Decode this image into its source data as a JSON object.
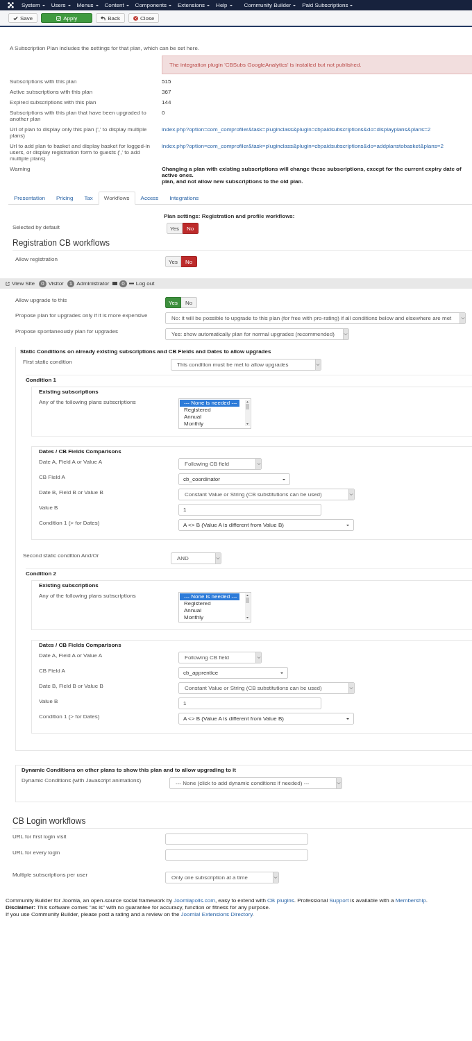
{
  "menubar": {
    "items": [
      "System",
      "Users",
      "Menus",
      "Content",
      "Components",
      "Extensions",
      "Help",
      "Community Builder",
      "Paid Subscriptions"
    ]
  },
  "toolbar": {
    "buttons": [
      {
        "label": "Save",
        "kind": "save"
      },
      {
        "label": "Apply",
        "kind": "apply"
      },
      {
        "label": "Back",
        "kind": "back"
      },
      {
        "label": "Close",
        "kind": "close"
      }
    ]
  },
  "intro": "A Subscription Plan includes the settings for that plan, which can be set here.",
  "alert": "The integration plugin 'CBSubs GoogleAnalytics' is installed but not published.",
  "info_rows": [
    {
      "kind": "text",
      "label": "Subscriptions with this plan",
      "value": "515"
    },
    {
      "kind": "text",
      "label": "Active subscriptions with this plan",
      "value": "367"
    },
    {
      "kind": "text",
      "label": "Expired subscriptions with this plan",
      "value": "144"
    },
    {
      "kind": "text",
      "label": "Subscriptions with this plan that have been upgraded to another plan",
      "value": "0"
    },
    {
      "kind": "link",
      "label": "Url of plan to display only this plan (',' to display multiple plans)",
      "value": "index.php?option=com_comprofiler&task=pluginclass&plugin=cbpaidsubscriptions&do=displayplans&plans=2"
    },
    {
      "kind": "link",
      "label": "Url to add plan to basket and display basket for logged-in users, or display registration form to guests (',' to add multiple plans)",
      "value": "index.php?option=com_comprofiler&task=pluginclass&plugin=cbpaidsubscriptions&do=addplanstobasket&plans=2"
    },
    {
      "kind": "warning",
      "label": "Warning",
      "lines": [
        "Changing a plan with existing subscriptions will change these subscriptions, except for the current expiry date of active ones.",
        "plan, and not allow new subscriptions to the old plan."
      ]
    }
  ],
  "tabs": [
    {
      "label": "Presentation",
      "selected": false
    },
    {
      "label": "Pricing",
      "selected": false
    },
    {
      "label": "Tax",
      "selected": false
    },
    {
      "label": "Workflows",
      "selected": true
    },
    {
      "label": "Access",
      "selected": false
    },
    {
      "label": "Integrations",
      "selected": false
    }
  ],
  "plan_settings_heading": "Plan settings: Registration and profile workflows:",
  "selected_by_default": {
    "kind": "toggle",
    "label": "Selected by default",
    "options": [
      {
        "label": "Yes",
        "selected": false
      },
      {
        "label": "No",
        "selected": true
      }
    ]
  },
  "registration": {
    "title": "Registration CB workflows",
    "rows": [
      {
        "kind": "toggle",
        "label": "Allow registration",
        "options": [
          {
            "label": "Yes",
            "selected": false
          },
          {
            "label": "No",
            "selected": true
          }
        ]
      }
    ]
  },
  "status_bar": {
    "items": [
      {
        "kind": "link",
        "label": "View Site"
      },
      {
        "kind": "badge",
        "count": "0",
        "label": "Visitor"
      },
      {
        "kind": "badge",
        "count": "1",
        "label": "Administrator"
      },
      {
        "kind": "mail",
        "count": "0"
      },
      {
        "kind": "logout",
        "label": "Log out"
      }
    ]
  },
  "upgrade_rows": [
    {
      "kind": "toggle",
      "label": "Allow upgrade to this",
      "options": [
        {
          "label": "Yes",
          "selected": true
        },
        {
          "label": "No",
          "selected": false
        }
      ]
    },
    {
      "kind": "select",
      "label": "Propose plan for upgrades only if it is more expensive",
      "value": "No: it will be possible to upgrade to this plan (for free with pro-rating) if all conditions below and elsewhere are met"
    },
    {
      "kind": "select",
      "label": "Propose spontaneously plan for upgrades",
      "value": "Yes: show automatically plan for normal upgrades (recommended)"
    }
  ],
  "static_conditions": {
    "title": "Static Conditions on already existing subscriptions and CB Fields and Dates to allow upgrades",
    "items": [
      {
        "kind": "select",
        "label": "First static condition",
        "value": "This condition must be met to allow upgrades"
      },
      {
        "kind": "condition",
        "title": "Condition 1",
        "existing": {
          "title": "Existing subscriptions",
          "label": "Any of the following plans subscriptions",
          "options": [
            {
              "label": "--- None is needed ---",
              "selected": true
            },
            {
              "label": "Registered",
              "selected": false
            },
            {
              "label": "Annual",
              "selected": false
            },
            {
              "label": "Monthly",
              "selected": false
            }
          ]
        },
        "comparisons": {
          "title": "Dates / CB Fields Comparisons",
          "rows": [
            {
              "kind": "select",
              "label": "Date A, Field A or Value A",
              "value": "Following CB field"
            },
            {
              "kind": "dropdown",
              "label": "CB Field A",
              "value": "cb_coordinator"
            },
            {
              "kind": "select",
              "label": "Date B, Field B or Value B",
              "value": "Constant Value or String (CB substitutions can be used)"
            },
            {
              "kind": "input",
              "label": "Value B",
              "value": "1"
            },
            {
              "kind": "dropdown",
              "label": "Condition 1 (> for Dates)",
              "value": "A <> B (Value A is different from Value B)"
            }
          ]
        }
      },
      {
        "kind": "select",
        "label": "Second static condition And/Or",
        "value": "AND"
      },
      {
        "kind": "condition",
        "title": "Condition 2",
        "existing": {
          "title": "Existing subscriptions",
          "label": "Any of the following plans subscriptions",
          "options": [
            {
              "label": "--- None is needed ---",
              "selected": true
            },
            {
              "label": "Registered",
              "selected": false
            },
            {
              "label": "Annual",
              "selected": false
            },
            {
              "label": "Monthly",
              "selected": false
            }
          ]
        },
        "comparisons": {
          "title": "Dates / CB Fields Comparisons",
          "rows": [
            {
              "kind": "select",
              "label": "Date A, Field A or Value A",
              "value": "Following CB field"
            },
            {
              "kind": "dropdown",
              "label": "CB Field A",
              "value": "cb_apprentice"
            },
            {
              "kind": "select",
              "label": "Date B, Field B or Value B",
              "value": "Constant Value or String (CB substitutions can be used)"
            },
            {
              "kind": "input",
              "label": "Value B",
              "value": "1"
            },
            {
              "kind": "dropdown",
              "label": "Condition 1 (> for Dates)",
              "value": "A <> B (Value A is different from Value B)"
            }
          ]
        }
      }
    ]
  },
  "dynamic_conditions": {
    "title": "Dynamic Conditions on other plans to show this plan and to allow upgrading to it",
    "rows": [
      {
        "kind": "select",
        "label": "Dynamic Conditions (with Javascript animations)",
        "value": "--- None (click to add dynamic conditions if needed) ---"
      }
    ]
  },
  "login": {
    "title": "CB Login workflows",
    "rows": [
      {
        "kind": "input",
        "label": "URL for first login visit"
      },
      {
        "kind": "input",
        "label": "URL for every login"
      },
      {
        "kind": "select",
        "label": "Multiple subscriptions per user",
        "value": "Only one subscription at a time"
      }
    ]
  },
  "footer": [
    [
      {
        "text": "Community Builder for Joomla, an open-source social framework by ",
        "kind": "text"
      },
      {
        "text": "Joomlapolis.com",
        "kind": "link"
      },
      {
        "text": ", easy to extend with ",
        "kind": "text"
      },
      {
        "text": "CB plugins",
        "kind": "link"
      },
      {
        "text": ". Professional ",
        "kind": "text"
      },
      {
        "text": "Support",
        "kind": "link"
      },
      {
        "text": " is available with a ",
        "kind": "text"
      },
      {
        "text": "Membership",
        "kind": "link"
      },
      {
        "text": ".",
        "kind": "text"
      }
    ],
    [
      {
        "text": "**Disclaimer:** This software comes \"as is\" with no guarantee for accuracy, function or fitness for any purpose.",
        "kind": "text"
      }
    ],
    [
      {
        "text": "If you use Community Builder, please post a rating and a review on the ",
        "kind": "text"
      },
      {
        "text": "Joomla! Extensions Directory",
        "kind": "link"
      },
      {
        "text": ".",
        "kind": "text"
      }
    ]
  ]
}
